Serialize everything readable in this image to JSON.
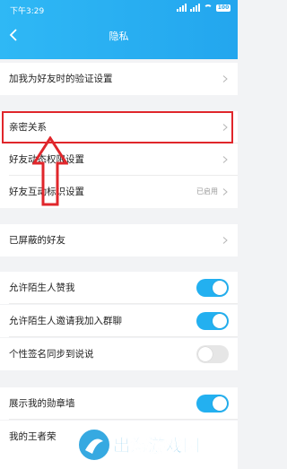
{
  "status_bar": {
    "time": "下午3:29",
    "battery": "100"
  },
  "header": {
    "title": "隐私"
  },
  "rows": {
    "verification": {
      "label": "加我为好友时的验证设置"
    },
    "intimate": {
      "label": "亲密关系"
    },
    "moments_permission": {
      "label": "好友动态权限设置"
    },
    "interaction_marks": {
      "label": "好友互动标识设置",
      "status": "已启用"
    },
    "blocked": {
      "label": "已屏蔽的好友"
    },
    "allow_stranger_like": {
      "label": "允许陌生人赞我",
      "enabled": true
    },
    "allow_stranger_group": {
      "label": "允许陌生人邀请我加入群聊",
      "enabled": true
    },
    "signature_sync": {
      "label": "个性签名同步到说说",
      "enabled": false
    },
    "show_medals": {
      "label": "展示我的勋章墙",
      "enabled": true
    },
    "honor_of_kings": {
      "label": "我的王者荣"
    }
  },
  "watermark": {
    "text": "出海游戏园"
  },
  "colors": {
    "accent": "#23b0f0",
    "highlight": "#e0262b",
    "header": "#23a6ee"
  }
}
